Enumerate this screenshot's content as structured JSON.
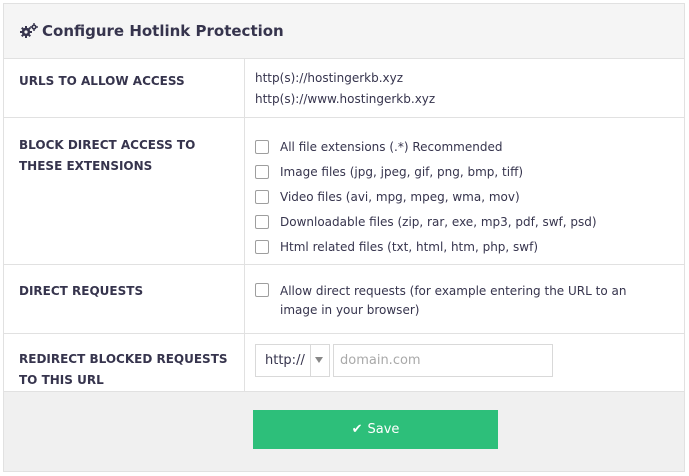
{
  "header": {
    "title": "Configure Hotlink Protection",
    "icon": "gears-icon"
  },
  "urls_row": {
    "label": "URLS TO ALLOW ACCESS",
    "urls": [
      "http(s)://hostingerkb.xyz",
      "http(s)://www.hostingerkb.xyz"
    ]
  },
  "extensions_row": {
    "label": "BLOCK DIRECT ACCESS TO THESE EXTENSIONS",
    "options": [
      {
        "label": "All file extensions (.*) Recommended",
        "checked": false
      },
      {
        "label": "Image files (jpg, jpeg, gif, png, bmp, tiff)",
        "checked": false
      },
      {
        "label": "Video files (avi, mpg, mpeg, wma, mov)",
        "checked": false
      },
      {
        "label": "Downloadable files (zip, rar, exe, mp3, pdf, swf, psd)",
        "checked": false
      },
      {
        "label": "Html related files (txt, html, htm, php, swf)",
        "checked": false
      }
    ]
  },
  "direct_row": {
    "label": "DIRECT REQUESTS",
    "option_label": "Allow direct requests (for example entering the URL to an image in your browser)",
    "checked": false
  },
  "redirect_row": {
    "label": "REDIRECT BLOCKED REQUESTS TO THIS URL",
    "protocol": "http://",
    "domain_placeholder": "domain.com",
    "domain_value": ""
  },
  "footer": {
    "save_label": "Save",
    "save_color": "#2dbf7a"
  }
}
